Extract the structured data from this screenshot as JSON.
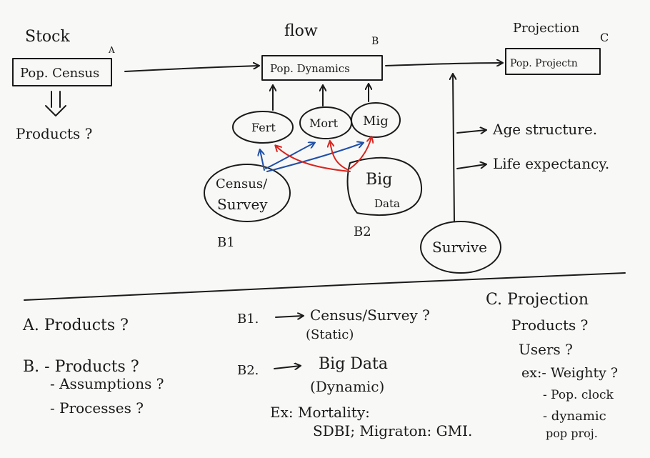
{
  "colors": {
    "ink": "#1a1a1a",
    "blue_arrows": "#1f4fa8",
    "red_arrows": "#d8261f",
    "paper": "#f8f8f6"
  },
  "top": {
    "stock_header": "Stock",
    "flow_header": "flow",
    "projection_header": "Projection",
    "label_a": "A",
    "label_b": "B",
    "label_c": "C",
    "box_a": "Pop. Census",
    "box_b": "Pop. Dynamics",
    "box_c": "Pop. Projectn",
    "products_q": "Products ?"
  },
  "nodes": {
    "fert": "Fert",
    "mort": "Mort",
    "mig": "Mig",
    "census_line1": "Census/",
    "census_line2": "Survey",
    "bigdata_line1": "Big",
    "bigdata_line2": "Data",
    "b1": "B1",
    "b2": "B2",
    "survive": "Survive",
    "age_structure": "Age structure.",
    "life_expectancy": "Life expectancy."
  },
  "notes": {
    "a_line": "A. Products ?",
    "b_line1": "B. - Products ?",
    "b_line2": "- Assumptions ?",
    "b_line3": "- Processes ?",
    "b1_line1": "B1.",
    "b1_line1b": "Census/Survey ?",
    "b1_line2": "(Static)",
    "b2_line1": "B2.",
    "b2_line1b": "Big Data",
    "b2_line2": "(Dynamic)",
    "ex_line": "Ex: Mortality:",
    "sdb_line": "SDBI; Migraton: GMI.",
    "c_line1": "C. Projection",
    "c_line2": "Products ?",
    "c_line3": "Users ?",
    "c_line4": "ex:- Weighty ?",
    "c_line5": "- Pop. clock",
    "c_line6": "- dynamic",
    "c_line7": "pop proj."
  }
}
